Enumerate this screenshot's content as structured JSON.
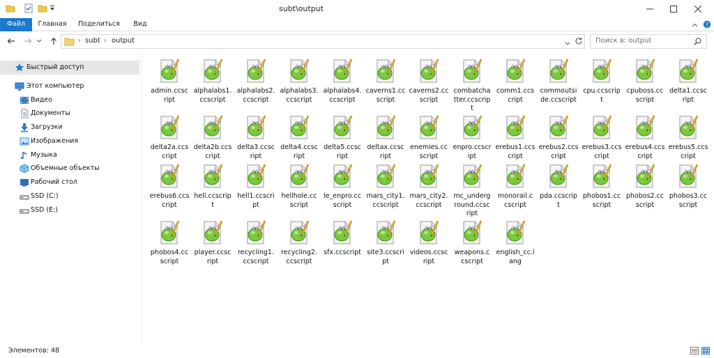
{
  "window": {
    "title": "subt\\output"
  },
  "ribbon": {
    "tabs": [
      "Файл",
      "Главная",
      "Поделиться",
      "Вид"
    ]
  },
  "address": {
    "crumbs": [
      "subt",
      "output"
    ]
  },
  "search": {
    "placeholder": "Поиск в: output"
  },
  "sidebar": {
    "items": [
      {
        "label": "Быстрый доступ",
        "icon": "star-icon",
        "color": "#2b79d6"
      },
      {
        "label": "Этот компьютер",
        "icon": "computer-icon",
        "color": "#3a8de0"
      },
      {
        "label": "Видео",
        "icon": "video-folder-icon",
        "color": "#3d7dbf"
      },
      {
        "label": "Документы",
        "icon": "documents-folder-icon",
        "color": "#7c8fa3"
      },
      {
        "label": "Загрузки",
        "icon": "downloads-folder-icon",
        "color": "#2b79d6"
      },
      {
        "label": "Изображения",
        "icon": "pictures-folder-icon",
        "color": "#4a90d9"
      },
      {
        "label": "Музыка",
        "icon": "music-folder-icon",
        "color": "#2b79d6"
      },
      {
        "label": "Объемные объекты",
        "icon": "3d-objects-folder-icon",
        "color": "#3aa0e0"
      },
      {
        "label": "Рабочий стол",
        "icon": "desktop-folder-icon",
        "color": "#2f6fb8"
      },
      {
        "label": "SSD (C:)",
        "icon": "drive-icon",
        "color": "#555555"
      },
      {
        "label": "SSD (E:)",
        "icon": "drive-icon",
        "color": "#555555"
      }
    ]
  },
  "files": [
    [
      "admin.ccsc",
      "ript"
    ],
    [
      "alphalabs1.",
      "ccscript"
    ],
    [
      "alphalabs2.",
      "ccscript"
    ],
    [
      "alphalabs3.",
      "ccscript"
    ],
    [
      "alphalabs4.",
      "ccscript"
    ],
    [
      "caverns1.cc",
      "script"
    ],
    [
      "caverns2.cc",
      "script"
    ],
    [
      "combatcha",
      "tter.ccscrip",
      "t"
    ],
    [
      "comm1.ccs",
      "cript"
    ],
    [
      "commoutsi",
      "de.ccscript"
    ],
    [
      "cpu.ccscrip",
      "t"
    ],
    [
      "cpuboss.cc",
      "script"
    ],
    [
      "delta1.ccsc",
      "ript"
    ],
    [
      "delta2a.ccs",
      "cript"
    ],
    [
      "delta2b.ccs",
      "cript"
    ],
    [
      "delta3.ccsc",
      "ript"
    ],
    [
      "delta4.ccsc",
      "ript"
    ],
    [
      "delta5.ccsc",
      "ript"
    ],
    [
      "deltax.ccsc",
      "ript"
    ],
    [
      "enemies.cc",
      "script"
    ],
    [
      "enpro.ccscr",
      "ipt"
    ],
    [
      "erebus1.ccs",
      "cript"
    ],
    [
      "erebus2.ccs",
      "cript"
    ],
    [
      "erebus3.ccs",
      "cript"
    ],
    [
      "erebus4.ccs",
      "cript"
    ],
    [
      "erebus5.ccs",
      "cript"
    ],
    [
      "erebus6.ccs",
      "cript"
    ],
    [
      "hell.ccscrip",
      "t"
    ],
    [
      "hell1.ccscri",
      "pt"
    ],
    [
      "hellhole.cc",
      "script"
    ],
    [
      "le_enpro.cc",
      "script"
    ],
    [
      "mars_city1.",
      "ccscript"
    ],
    [
      "mars_city2.",
      "ccscript"
    ],
    [
      "mc_underg",
      "round.ccsc",
      "ript"
    ],
    [
      "monorail.c",
      "cscript"
    ],
    [
      "pda.ccscrip",
      "t"
    ],
    [
      "phobos1.cc",
      "script"
    ],
    [
      "phobos2.cc",
      "script"
    ],
    [
      "phobos3.cc",
      "script"
    ],
    [
      "phobos4.cc",
      "script"
    ],
    [
      "player.ccsc",
      "ript"
    ],
    [
      "recycling1.",
      "ccscript"
    ],
    [
      "recycling2.",
      "ccscript"
    ],
    [
      "sfx.ccscript"
    ],
    [
      "site3.ccscri",
      "pt"
    ],
    [
      "videos.ccsc",
      "ript"
    ],
    [
      "weapons.c",
      "cscript"
    ],
    [
      "english_cc.l",
      "ang"
    ]
  ],
  "file_icon": "notepad-plus-plus-file-icon",
  "status": {
    "count_text": "Элементов: 48"
  },
  "colors": {
    "accent": "#1979ca",
    "selected": "#e5e5e5"
  }
}
